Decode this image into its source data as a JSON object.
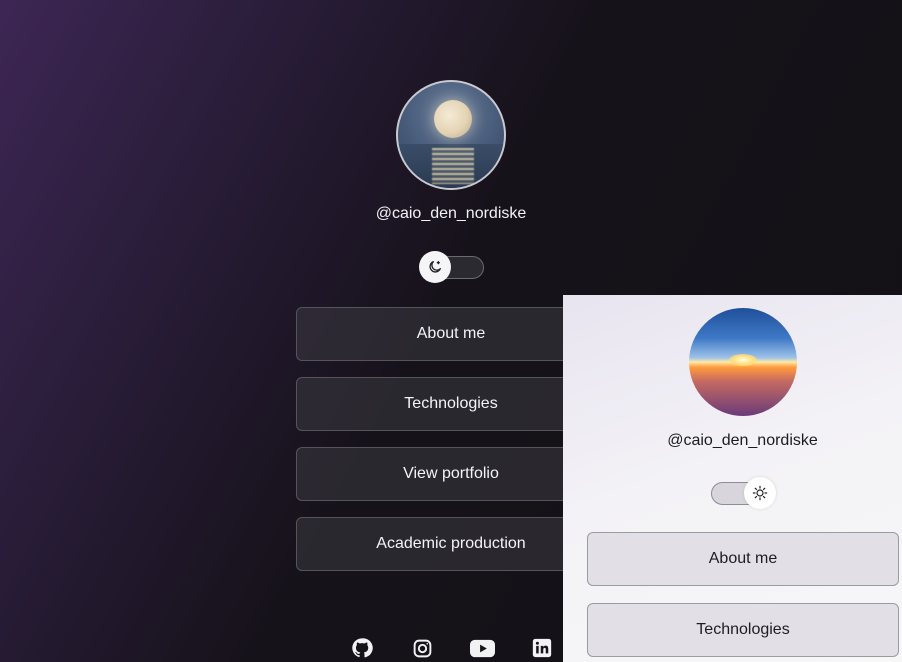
{
  "dark_view": {
    "avatar_alt": "moon over sea",
    "username": "@caio_den_nordiske",
    "theme_toggle": {
      "state": "dark",
      "icon": "moon-icon"
    },
    "buttons": [
      {
        "label": "About me"
      },
      {
        "label": "Technologies"
      },
      {
        "label": "View portfolio"
      },
      {
        "label": "Academic production"
      }
    ],
    "social_links": [
      {
        "icon": "github-icon"
      },
      {
        "icon": "instagram-icon"
      },
      {
        "icon": "youtube-icon"
      },
      {
        "icon": "linkedin-icon"
      }
    ]
  },
  "light_view": {
    "avatar_alt": "sunrise above clouds",
    "username": "@caio_den_nordiske",
    "theme_toggle": {
      "state": "light",
      "icon": "sun-icon"
    },
    "buttons": [
      {
        "label": "About me"
      },
      {
        "label": "Technologies"
      }
    ]
  },
  "colors": {
    "dark_background": "#121114",
    "dark_accent": "#3d2654",
    "light_background": "#f3f2f6"
  }
}
